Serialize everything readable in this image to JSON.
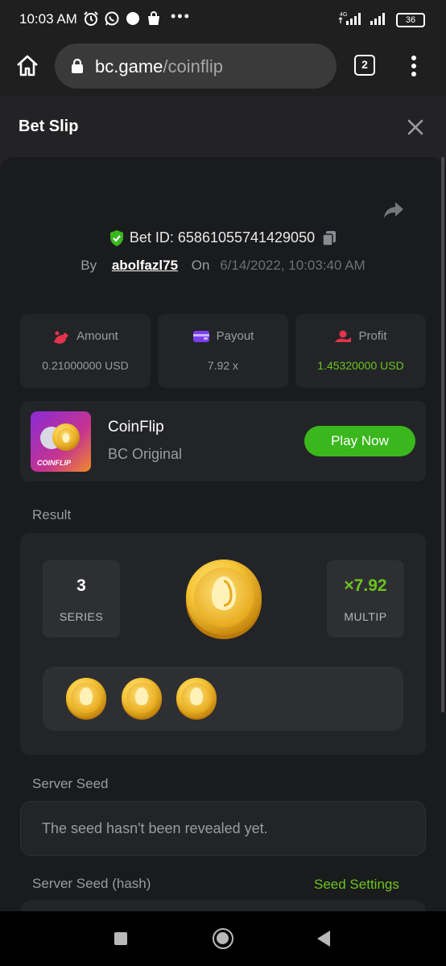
{
  "status_bar": {
    "time": "10:03 AM",
    "network": "4G",
    "battery": "36",
    "icons": [
      "alarm-icon",
      "whatsapp-icon",
      "circle-icon",
      "shopping-bag-icon",
      "more-dots-icon",
      "signal-icon",
      "signal-icon",
      "battery-icon"
    ],
    "more": "•••"
  },
  "browser": {
    "url_domain": "bc.game",
    "url_path": "/coinflip",
    "tab_count": "2",
    "icons": [
      "home-icon",
      "lock-icon",
      "tabs-icon",
      "menu-icon"
    ]
  },
  "bet_slip": {
    "title": "Bet Slip",
    "bet_id_label": "Bet ID: 65861055741429050",
    "by_label": "By",
    "username": "abolfazl75",
    "on_label": "On",
    "date": "6/14/2022, 10:03:40 AM",
    "icons": [
      "close-icon",
      "share-icon",
      "shield-check-icon",
      "copy-icon"
    ]
  },
  "stats": [
    {
      "label": "Amount",
      "value": "0.21000000 USD",
      "icon": "amount-icon",
      "color": "#e3344d"
    },
    {
      "label": "Payout",
      "value": "7.92 x",
      "icon": "wallet-icon",
      "color": "#7b3ff2"
    },
    {
      "label": "Profit",
      "value": "1.45320000 USD",
      "icon": "profit-icon",
      "color": "#e3344d"
    }
  ],
  "game": {
    "name": "CoinFlip",
    "provider": "BC Original",
    "thumb_text": "COINFLIP",
    "play_label": "Play Now"
  },
  "result": {
    "label": "Result",
    "series_value": "3",
    "series_label": "SERIES",
    "multiplier_value": "×7.92",
    "multiplier_label": "MULTIP",
    "coin_count": 3
  },
  "server_seed": {
    "label": "Server Seed",
    "value": "The seed hasn't been revealed yet."
  },
  "server_seed_hash": {
    "label": "Server Seed (hash)",
    "settings_link": "Seed Settings"
  },
  "colors": {
    "accent_green": "#6bc41e",
    "play_button": "#3ab71d",
    "panel": "#1a1b1d",
    "card": "#232427"
  }
}
